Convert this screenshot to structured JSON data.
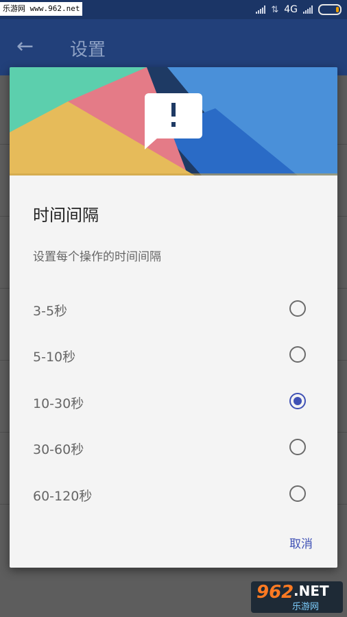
{
  "status_bar": {
    "watermark": "乐游网 www.962.net",
    "network": "4G"
  },
  "app_bar": {
    "back_icon": "arrow-left-icon",
    "title": "设置"
  },
  "dialog": {
    "title": "时间间隔",
    "subtitle": "设置每个操作的时间间隔",
    "options": [
      {
        "label": "3-5秒",
        "checked": false
      },
      {
        "label": "5-10秒",
        "checked": false
      },
      {
        "label": "10-30秒",
        "checked": true
      },
      {
        "label": "30-60秒",
        "checked": false
      },
      {
        "label": "60-120秒",
        "checked": false
      }
    ],
    "cancel_label": "取消",
    "accent_color": "#3f51b5"
  },
  "logo": {
    "big_text": "962",
    "net_text": ".NET",
    "cn_text": "乐游网"
  }
}
